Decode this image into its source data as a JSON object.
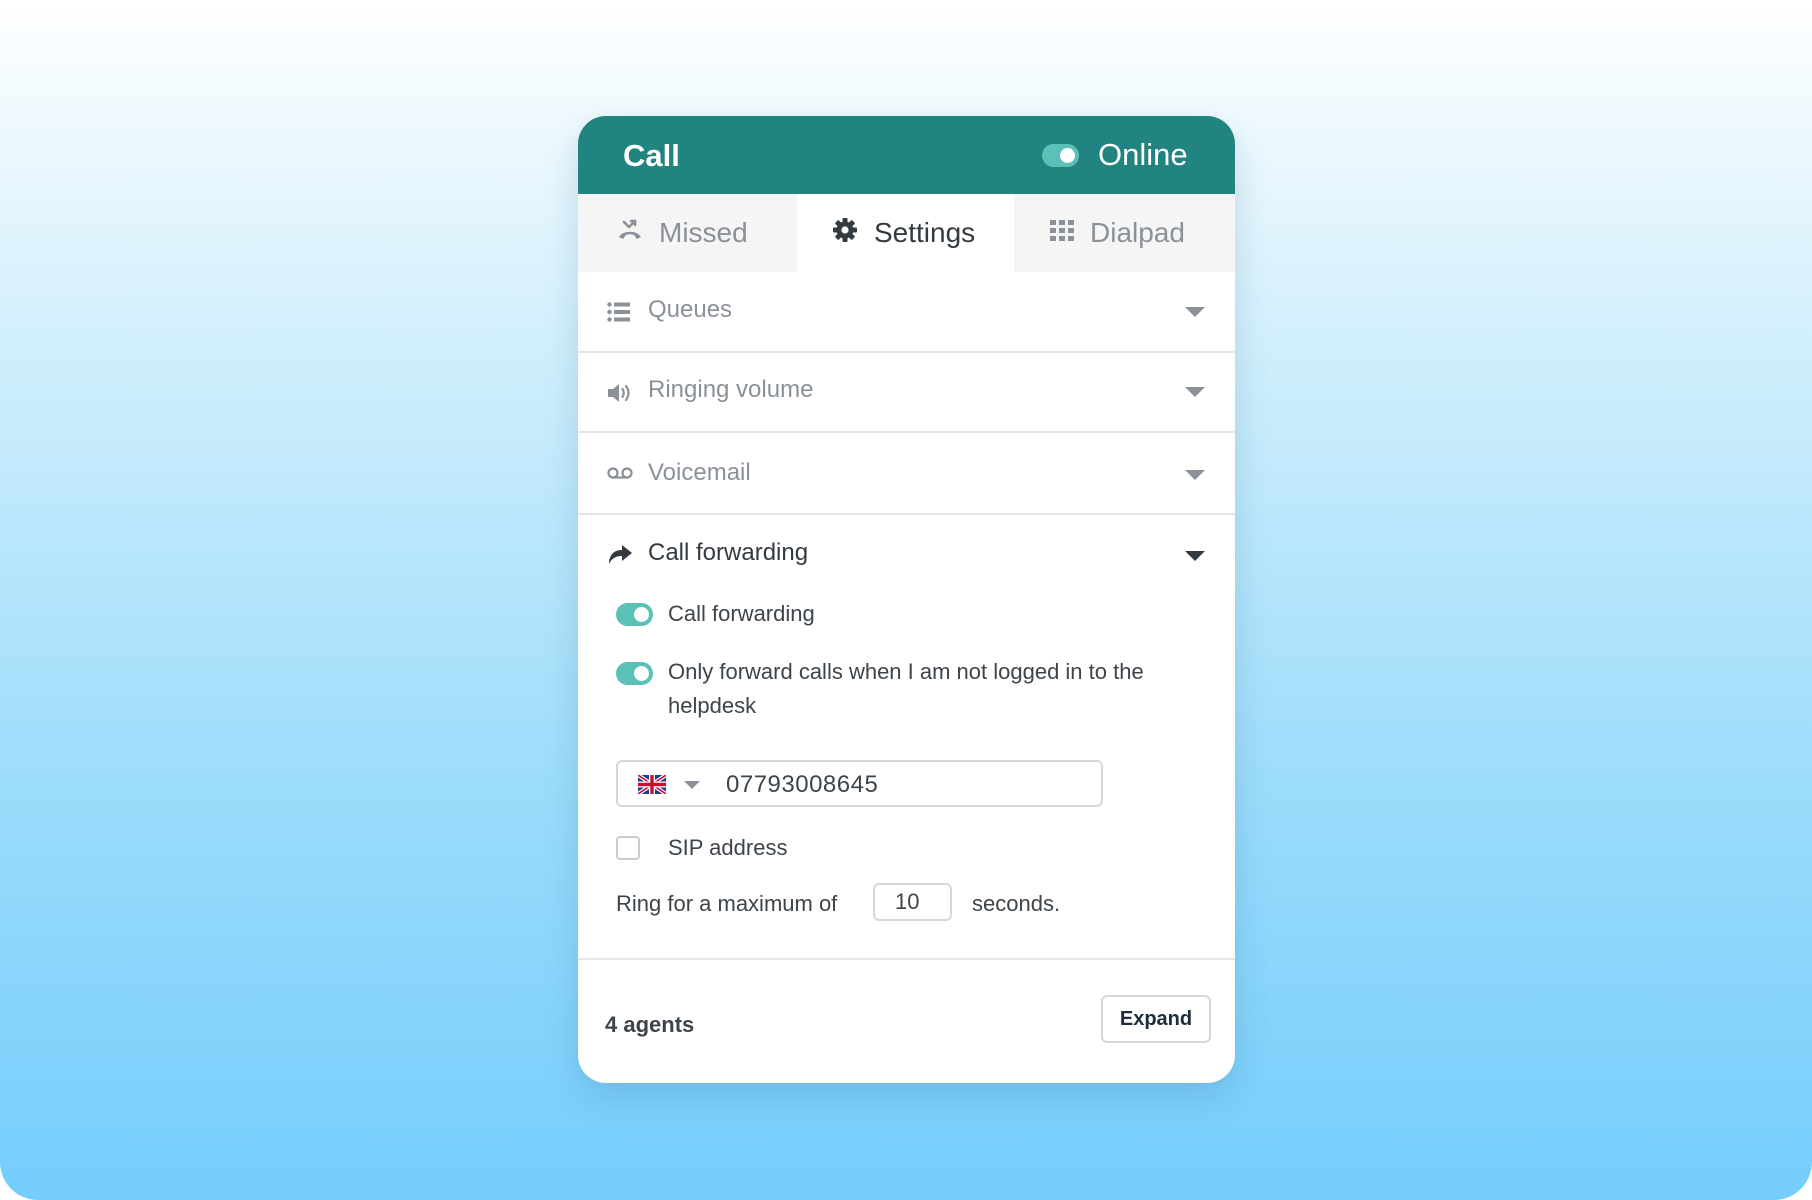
{
  "header": {
    "title": "Call",
    "status_label": "Online",
    "status_on": true
  },
  "tabs": [
    {
      "label": "Missed",
      "icon": "missed-call-icon",
      "active": false
    },
    {
      "label": "Settings",
      "icon": "gear-icon",
      "active": true
    },
    {
      "label": "Dialpad",
      "icon": "dialpad-grid-icon",
      "active": false
    }
  ],
  "sections": {
    "queues": {
      "label": "Queues",
      "icon": "queue-list-icon",
      "expanded": false
    },
    "ringing_volume": {
      "label": "Ringing volume",
      "icon": "speaker-icon",
      "expanded": false
    },
    "voicemail": {
      "label": "Voicemail",
      "icon": "voicemail-icon",
      "expanded": false
    },
    "call_forwarding": {
      "label": "Call forwarding",
      "icon": "forward-arrow-icon",
      "expanded": true,
      "forwarding_toggle": {
        "label": "Call forwarding",
        "on": true
      },
      "only_when_offline_toggle": {
        "label_line1": "Only forward calls when I am not logged in to the",
        "label_line2": "helpdesk",
        "on": true
      },
      "phone": {
        "country_icon": "uk-flag-icon",
        "number": "07793008645"
      },
      "sip": {
        "label": "SIP address",
        "checked": false
      },
      "ring": {
        "prefix": "Ring for a maximum of",
        "value": "10",
        "suffix": "seconds."
      }
    }
  },
  "footer": {
    "agents": "4 agents",
    "expand_label": "Expand"
  },
  "colors": {
    "header_bg": "#228480",
    "toggle_on": "#5bc0b6",
    "text_dark": "#333a40",
    "text_muted": "#8a9198"
  }
}
